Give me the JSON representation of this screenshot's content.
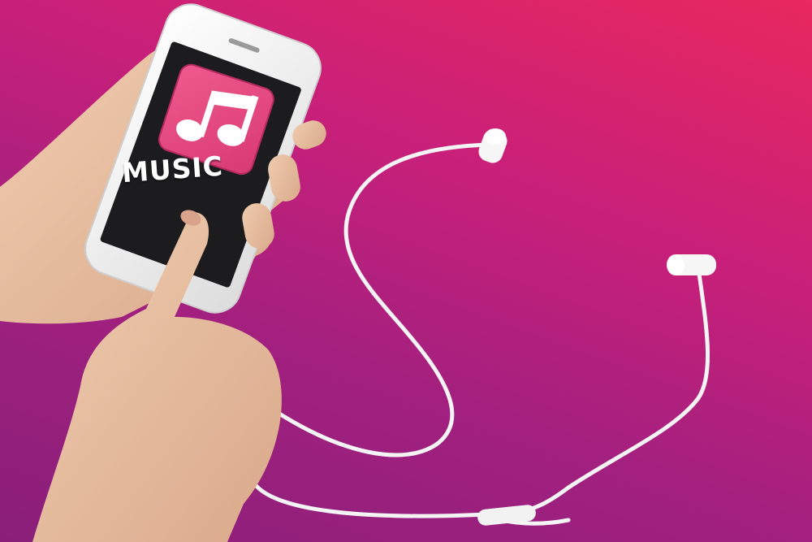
{
  "screen": {
    "label": "MUSIC",
    "icon": "music-note-icon"
  },
  "colors": {
    "background_top_right": "#e8285e",
    "background_bottom_left": "#8a1f7a",
    "app_icon": "#e4487e",
    "screen": "#1c1c1e",
    "phone_body": "#f2f2f2",
    "earphones": "#f4f4f4",
    "skin": "#e6bfa2"
  }
}
